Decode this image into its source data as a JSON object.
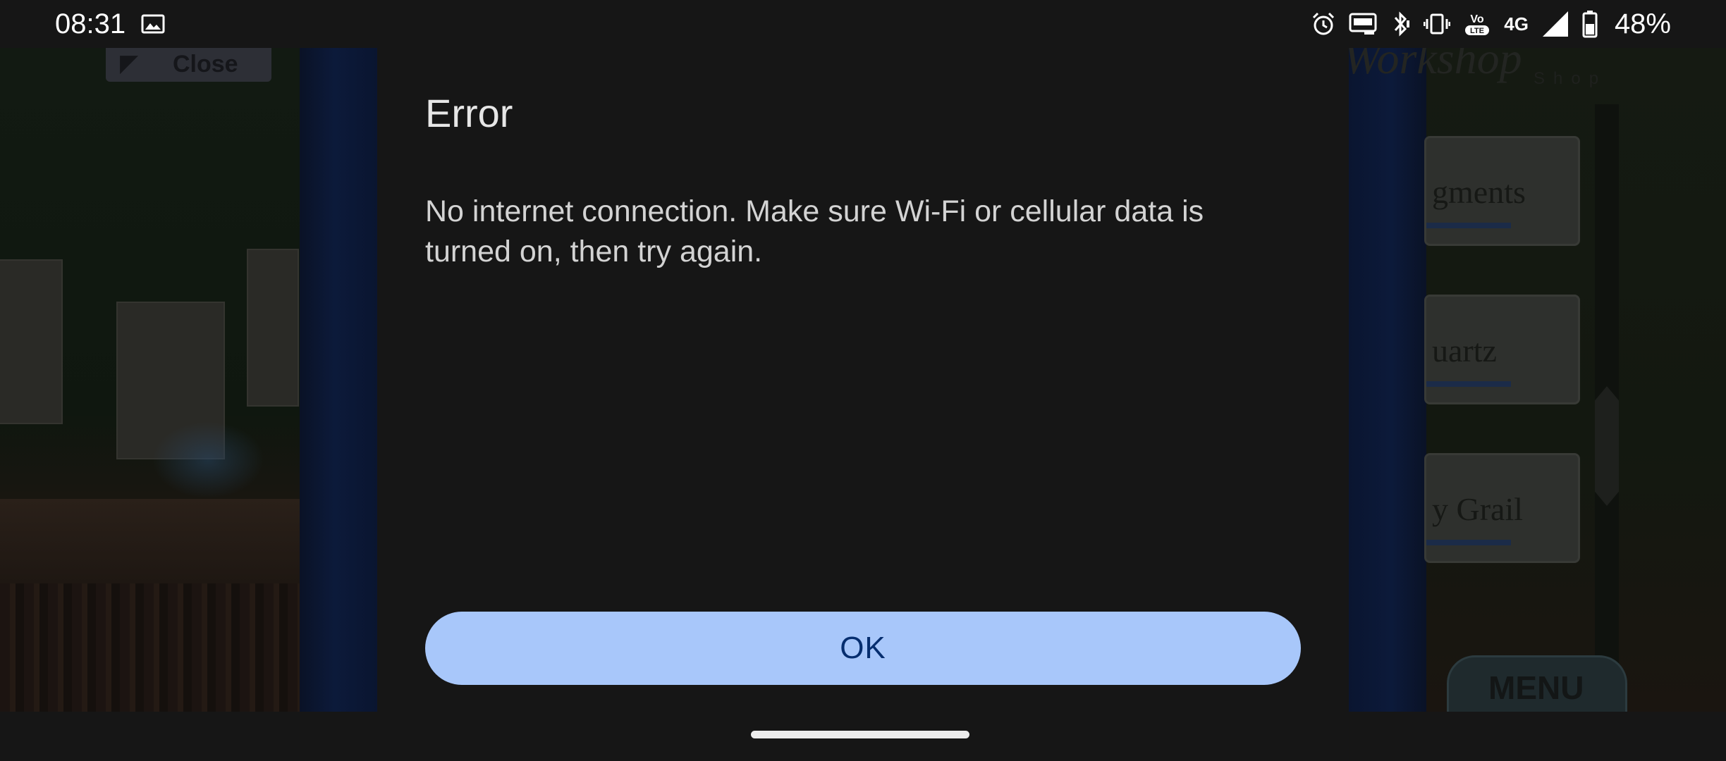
{
  "status_bar": {
    "time": "08:31",
    "network_label": "4G",
    "battery_percent": "48%",
    "icons": [
      "gallery-icon",
      "alarm-icon",
      "auto-hz-icon",
      "bluetooth-icon",
      "vibrate-icon",
      "volte-icon",
      "signal-icon",
      "battery-icon"
    ]
  },
  "background_app": {
    "close_label": "Close",
    "shop_title": "Workshop",
    "shop_subtitle": "Shop",
    "shop_items": [
      "gments",
      "uartz",
      "y Grail"
    ],
    "menu_label": "MENU"
  },
  "dialog": {
    "title": "Error",
    "message": "No internet connection. Make sure Wi-Fi or cellular data is turned on, then try again.",
    "ok_label": "OK",
    "accent_color": "#a8c7fa"
  }
}
